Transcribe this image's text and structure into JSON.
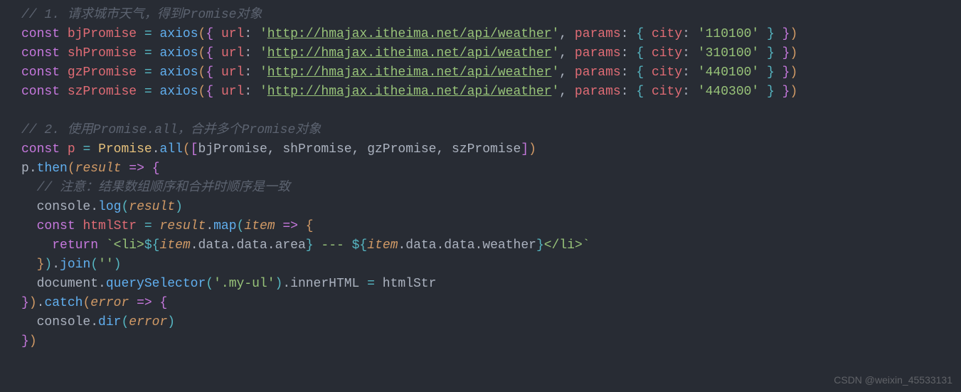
{
  "watermark": "CSDN @weixin_45533131",
  "comments": {
    "c1": "// 1. 请求城市天气，得到Promise对象",
    "c2": "// 2. 使用Promise.all，合并多个Promise对象",
    "c3": "// 注意：结果数组顺序和合并时顺序是一致"
  },
  "promises": [
    {
      "name": "bjPromise",
      "url": "http://hmajax.itheima.net/api/weather",
      "city": "110100"
    },
    {
      "name": "shPromise",
      "url": "http://hmajax.itheima.net/api/weather",
      "city": "310100"
    },
    {
      "name": "gzPromise",
      "url": "http://hmajax.itheima.net/api/weather",
      "city": "440100"
    },
    {
      "name": "szPromise",
      "url": "http://hmajax.itheima.net/api/weather",
      "city": "440300"
    }
  ],
  "tokens": {
    "const": "const",
    "axios": "axios",
    "url": "url",
    "params": "params",
    "city": "city",
    "p": "p",
    "Promise": "Promise",
    "all": "all",
    "then": "then",
    "catch": "catch",
    "result": "result",
    "error": "error",
    "console": "console",
    "log": "log",
    "dir": "dir",
    "htmlStr": "htmlStr",
    "map": "map",
    "item": "item",
    "return": "return",
    "data": "data",
    "area": "area",
    "weather": "weather",
    "join": "join",
    "document": "document",
    "querySelector": "querySelector",
    "selector": "'.my-ul'",
    "innerHTML": "innerHTML",
    "arrow": "=>",
    "eq": "=",
    "li_open": "<li>",
    "li_close": "</li>",
    "sep": " --- ",
    "empty": "''",
    "backtick": "`",
    "tmpl_open": "${",
    "tmpl_close": "}",
    "dot": "."
  }
}
